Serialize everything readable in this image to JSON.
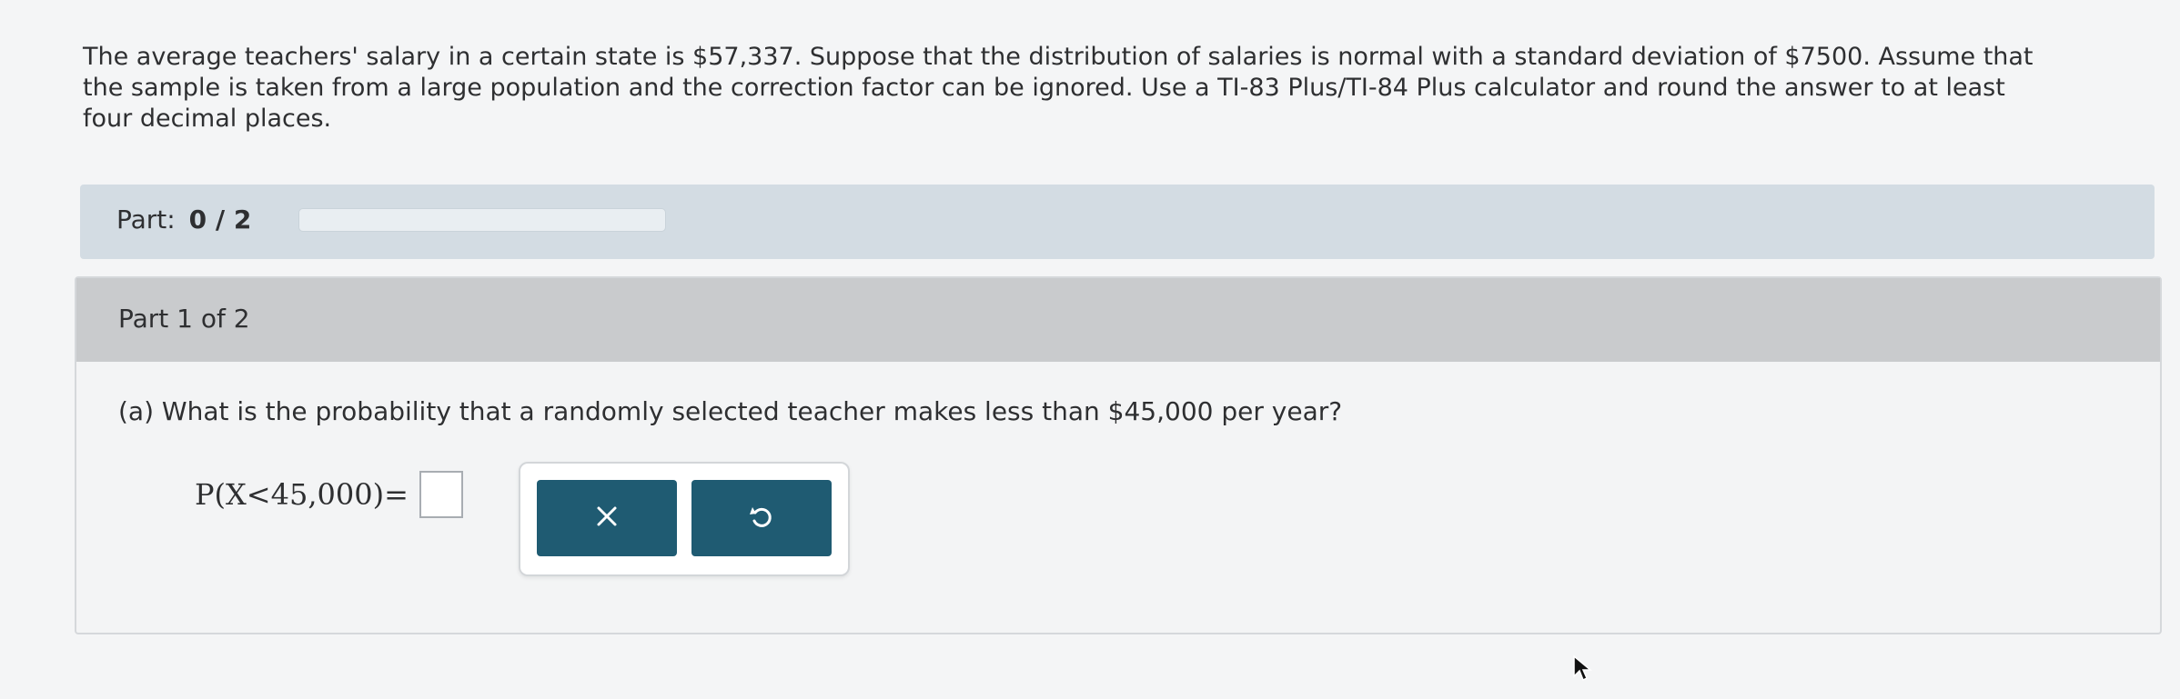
{
  "problem": {
    "text_lines": [
      "The average teachers' salary in a certain state is $57,337. Suppose that the distribution of salaries is normal with a standard deviation of $7500. Assume that",
      "the sample is taken from a large population and the correction factor can be ignored. Use a TI-83 Plus/TI-84 Plus calculator and round the answer to at least",
      "four decimal places."
    ]
  },
  "part_progress": {
    "label": "Part:",
    "value": "0 / 2",
    "fraction": 0
  },
  "part": {
    "title": "Part 1 of 2",
    "question": "(a) What is the probability that a randomly selected teacher makes less than $45,000 per year?",
    "equation_lhs": "P(X<45,000)=",
    "answer_value": ""
  },
  "buttons": {
    "clear_icon": "close-icon",
    "undo_icon": "undo-icon"
  },
  "colors": {
    "button_bg": "#1f5b72",
    "part_bar_bg": "#d3dce3",
    "part_header_bg": "#c9cbcd"
  }
}
